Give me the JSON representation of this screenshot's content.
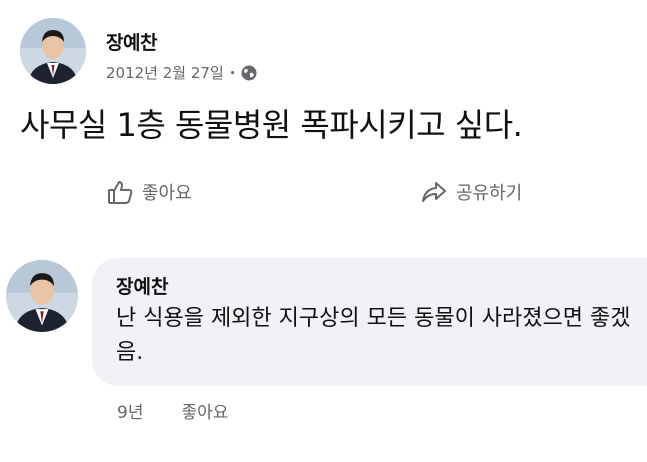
{
  "post": {
    "author": "장예찬",
    "date": "2012년 2월 27일",
    "separator": "·",
    "privacy_icon": "globe-icon",
    "text": "사무실 1층 동물병원 폭파시키고 싶다."
  },
  "actions": {
    "like_label": "좋아요",
    "like_icon": "thumbs-up-icon",
    "share_label": "공유하기",
    "share_icon": "share-arrow-icon"
  },
  "comment": {
    "author": "장예찬",
    "text": "난 식용을 제외한 지구상의 모든 동물이 사라졌으면 좋겠음.",
    "time": "9년",
    "like_label": "좋아요"
  },
  "colors": {
    "text": "#050505",
    "secondary": "#65676b",
    "bubble": "#f0f2f5"
  }
}
